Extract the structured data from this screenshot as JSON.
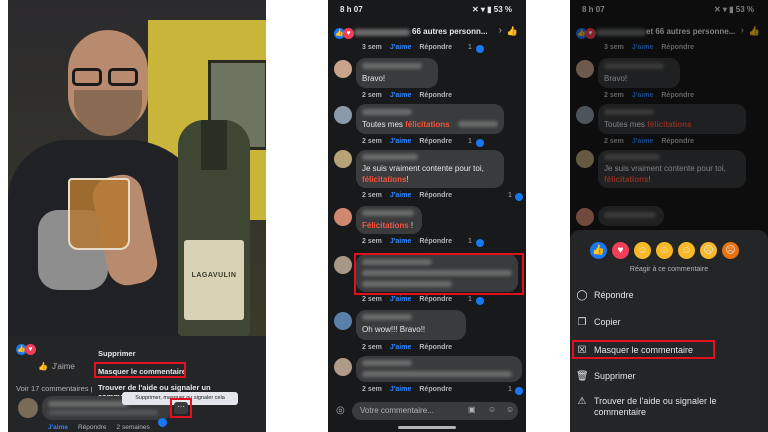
{
  "panel1": {
    "bottle_label": "LAGAVULIN",
    "jaime": "J'aime",
    "voir": "Voir 17 commentaires p",
    "menu": {
      "supprimer": "Supprimer",
      "masquer": "Masquer le commentaire",
      "trouver": "Trouver de l'aide ou signaler un commentaire"
    },
    "tooltip": "Supprimer, masquer ou signaler cela",
    "dots": "···",
    "meta": {
      "aime": "J'aime",
      "repondre": "Répondre",
      "time": "2 semaines"
    }
  },
  "panel2": {
    "status_time": "8 h 07",
    "status_battery": "53 %",
    "header": "66 autres personn...",
    "meta_aime": "J'aime",
    "meta_repondre": "Répondre",
    "meta_time": "2 sem",
    "meta_time_3": "3 sem",
    "comments": {
      "c1": "Bravo!",
      "c2_prefix": "Toutes mes ",
      "c2_red": "félicitations",
      "c3_line1": "Je suis vraiment contente pour toi,",
      "c3_red": "félicitations",
      "c3_suffix": "!",
      "c4_red": "Félicitations",
      "c4_suffix": " !",
      "c6": "Oh wow!!! Bravo!!"
    },
    "counts": [
      "1",
      "1",
      "1",
      "1",
      "1",
      "1"
    ],
    "composer_placeholder": "Votre commentaire..."
  },
  "panel3": {
    "status_time": "8 h 07",
    "status_battery": "53 %",
    "header": "et 66 autres personne...",
    "react_caption": "Réagir à ce commentaire",
    "items": {
      "repondre": "Répondre",
      "copier": "Copier",
      "masquer": "Masquer le commentaire",
      "supprimer": "Supprimer",
      "trouver_1": "Trouver de l'aide ou signaler le",
      "trouver_2": "commentaire"
    },
    "c1": "Bravo!",
    "c2_prefix": "Toutes mes ",
    "c2_red": "félicitations",
    "c3_line1": "Je suis vraiment contente pour toi,",
    "c3_red": "félicitations",
    "c3_suffix": "!"
  },
  "colors": {
    "highlight": "#e0121e",
    "fb_blue": "#2d88ff",
    "mention_red": "#f5533d",
    "dark_bg": "#18191a"
  }
}
